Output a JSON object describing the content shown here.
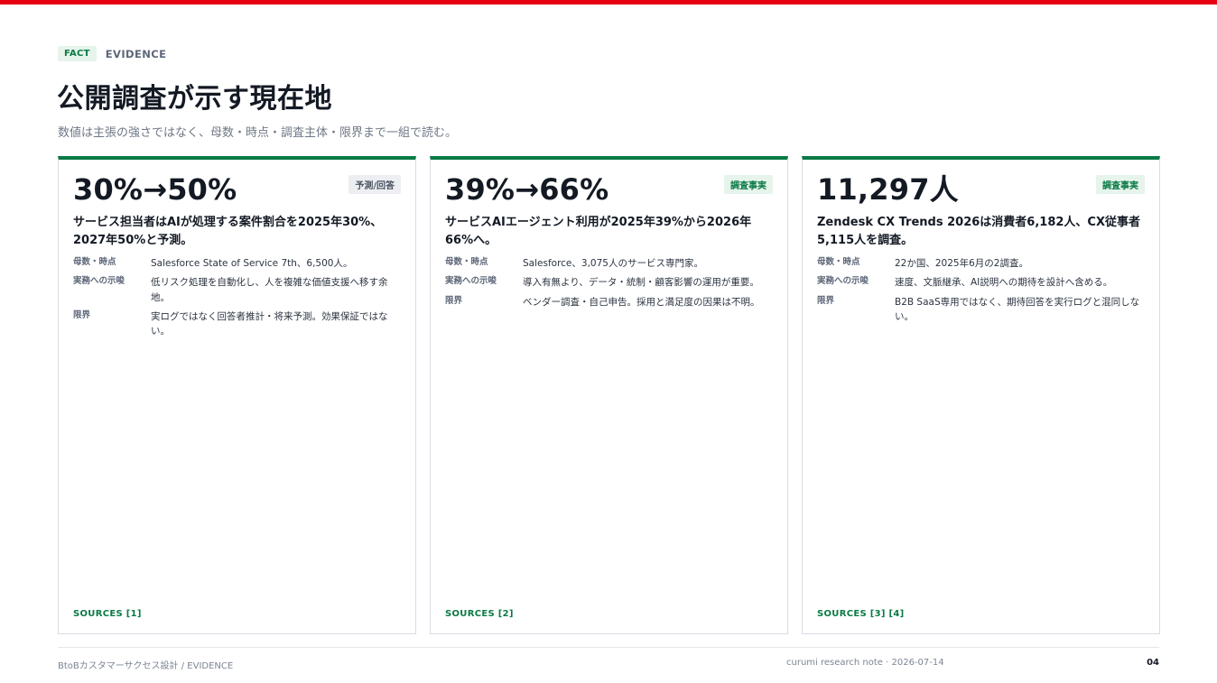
{
  "header": {
    "badge": "FACT",
    "eyebrow": "EVIDENCE",
    "title": "公開調査が示す現在地",
    "subtitle": "数値は主張の強さではなく、母数・時点・調査主体・限界まで一組で読む。"
  },
  "cards": [
    {
      "metric": "30%→50%",
      "tag": "予測/回答",
      "headline": "サービス担当者はAIが処理する案件割合を2025年30%、2027年50%と予測。",
      "rows": [
        {
          "key": "母数・時点",
          "value": "Salesforce State of Service 7th、6,500人。"
        },
        {
          "key": "実務への示唆",
          "value": "低リスク処理を自動化し、人を複雑な価値支援へ移す余地。"
        },
        {
          "key": "限界",
          "value": "実ログではなく回答者推計・将来予測。効果保証ではない。"
        }
      ],
      "sources": "SOURCES [1]"
    },
    {
      "metric": "39%→66%",
      "tag": "調査事実",
      "headline": "サービスAIエージェント利用が2025年39%から2026年66%へ。",
      "rows": [
        {
          "key": "母数・時点",
          "value": "Salesforce、3,075人のサービス専門家。"
        },
        {
          "key": "実務への示唆",
          "value": "導入有無より、データ・統制・顧客影響の運用が重要。"
        },
        {
          "key": "限界",
          "value": "ベンダー調査・自己申告。採用と満足度の因果は不明。"
        }
      ],
      "sources": "SOURCES [2]"
    },
    {
      "metric": "11,297人",
      "tag": "調査事実",
      "headline": "Zendesk CX Trends 2026は消費者6,182人、CX従事者5,115人を調査。",
      "rows": [
        {
          "key": "母数・時点",
          "value": "22か国、2025年6月の2調査。"
        },
        {
          "key": "実務への示唆",
          "value": "速度、文脈継承、AI説明への期待を設計へ含める。"
        },
        {
          "key": "限界",
          "value": "B2B SaaS専用ではなく、期待回答を実行ログと混同しない。"
        }
      ],
      "sources": "SOURCES [3] [4]"
    }
  ],
  "footer": {
    "left": "BtoBカスタマーサクセス設計 / EVIDENCE",
    "mid": "curumi research note · 2026-07-14",
    "page": "04"
  },
  "colors": {
    "accent_red": "#e60012",
    "accent_green": "#0a7a45"
  }
}
